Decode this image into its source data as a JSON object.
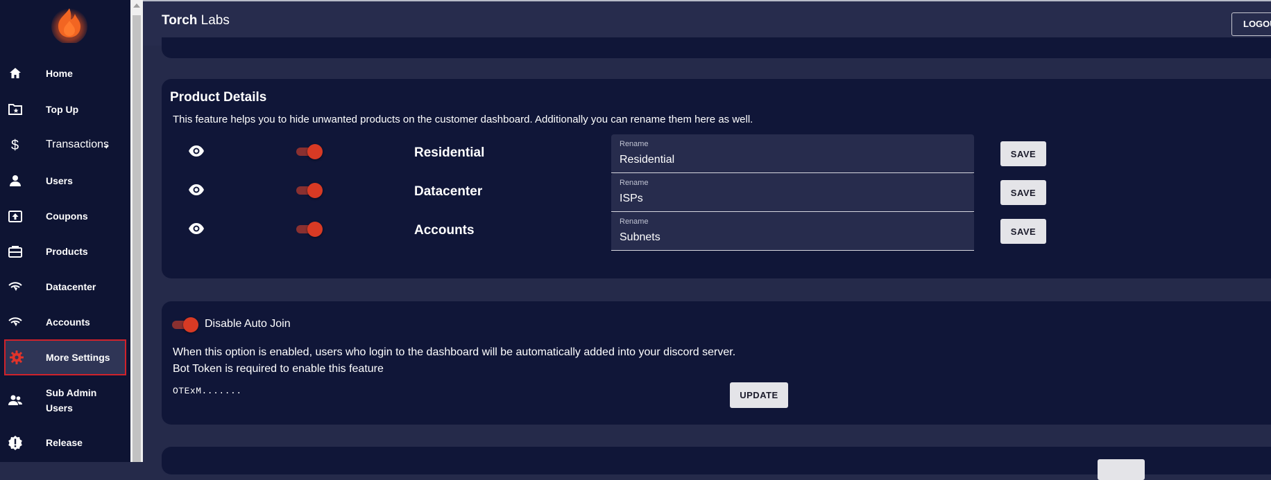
{
  "app": {
    "brand_bold": "Torch",
    "brand_rest": " Labs"
  },
  "header": {
    "logout_label": "LOGOUT"
  },
  "sidebar": {
    "items": [
      {
        "label": "Home",
        "icon": "home-icon"
      },
      {
        "label": "Top Up",
        "icon": "folder-star-icon"
      },
      {
        "label": "Transactions",
        "icon": "dollar-icon"
      },
      {
        "label": "Users",
        "icon": "person-icon"
      },
      {
        "label": "Coupons",
        "icon": "upload-box-icon"
      },
      {
        "label": "Products",
        "icon": "briefcase-icon"
      },
      {
        "label": "Datacenter",
        "icon": "signal-icon"
      },
      {
        "label": "Accounts",
        "icon": "signal-icon"
      },
      {
        "label": "More Settings",
        "icon": "gear-icon",
        "active": true
      },
      {
        "label": "Sub Admin\nUsers",
        "icon": "group-icon"
      },
      {
        "label": "Release",
        "icon": "alert-badge-icon"
      }
    ]
  },
  "product_details": {
    "title": "Product Details",
    "description": "This feature helps you to hide unwanted products on the customer dashboard. Additionally you can rename them here as well.",
    "rename_label": "Rename",
    "save_label": "SAVE",
    "rows": [
      {
        "name": "Residential",
        "rename_value": "Residential",
        "visible": true,
        "enabled": true
      },
      {
        "name": "Datacenter",
        "rename_value": "ISPs",
        "visible": true,
        "enabled": true
      },
      {
        "name": "Accounts",
        "rename_value": "Subnets",
        "visible": true,
        "enabled": true
      }
    ]
  },
  "auto_join": {
    "toggle_label": "Disable Auto Join",
    "enabled": true,
    "description_line1": "When this option is enabled, users who login to the dashboard will be automatically added into your discord server.",
    "description_line2": "Bot Token is required to enable this feature",
    "token_value": "OTExM.......",
    "update_label": "UPDATE"
  },
  "colors": {
    "accent": "#d83a24",
    "sidebar_bg": "#0e1433",
    "card_bg": "#101638",
    "page_bg": "#252a4a",
    "active_border": "#d0222b"
  }
}
